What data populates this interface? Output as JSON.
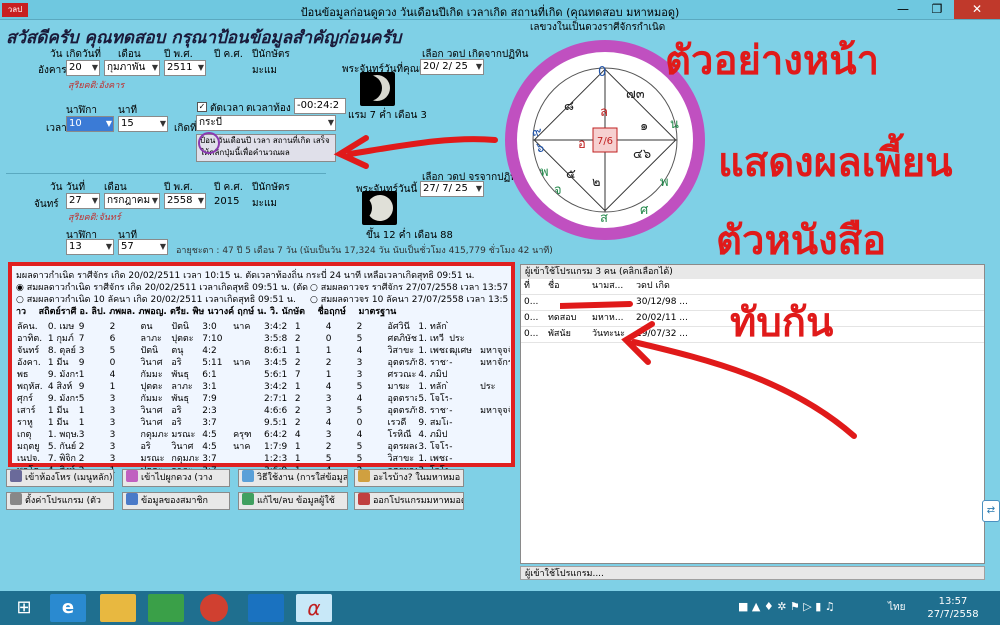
{
  "titlebar": {
    "badge": "วลป",
    "title": "ป้อนข้อมูลก่อนดูดวง วันเดือนปีเกิด เวลาเกิด สถานที่เกิด (คุณทดสอบ มหาหมอดู)"
  },
  "greeting": "สวัสดีครับ คุณทดสอบ กรุณาป้อนข้อมูลสำคัญก่อนครับ",
  "birth": {
    "h_day": "วัน",
    "h_date": "เกิดวันที่",
    "h_month": "เดือน",
    "h_year_be": "ปี พ.ศ.",
    "h_year_ce": "ปี ค.ศ.",
    "h_zodiac": "ปีนักษัตร",
    "weekday": "อังคาร",
    "date": "20",
    "month": "กุมภาพัน",
    "year_be": "2511",
    "year_ce": "",
    "zodiac": "มะแม",
    "sarit": "สุริยคติ:อังคาร",
    "h_hour": "นาฬิกา",
    "h_minute": "นาที",
    "time_label": "เวลา",
    "hour": "10",
    "minute": "15",
    "cut_label": "ตัดเวลา",
    "tz_label": "ตเวลาท้อง",
    "tz_value": "-00:24:2",
    "place_label": "เกิดที่",
    "place": "กระบี่",
    "note": "ป้อน วันเดือนปี เวลา สถานที่เกิด เสร็จให้คลิกปุ่มนี้เพื่อคำนวณผล",
    "moon_label": "พระจันทร์วันที่คุณเกิด",
    "moon_phase": "แรม 7 ค่ำ เดือน 3",
    "choose_label": "เลือก วดป เกิดจากปฏิทิน",
    "choose_value": "20/ 2/ 25"
  },
  "today": {
    "h_day": "วัน",
    "h_date": "วันที่",
    "h_month": "เดือน",
    "h_year_be": "ปี พ.ศ.",
    "h_year_ce": "ปี ค.ศ.",
    "h_zodiac": "ปีนักษัตร",
    "weekday": "จันทร์",
    "date": "27",
    "month": "กรกฎาคม",
    "year_be": "2558",
    "year_ce": "2015",
    "zodiac": "มะแม",
    "sarit": "สุริยคติ:จันทร์",
    "h_hour": "นาฬิกา",
    "h_minute": "นาที",
    "hour": "13",
    "minute": "57",
    "moon_label": "พระจันทร์วันนี้",
    "moon_phase": "ขึ้น 12 ค่ำ เดือน 88",
    "choose_label": "เลือก วดป จรจากปฏิทิน",
    "choose_value": "27/ 7/ 25",
    "age": "อายุชะตา : 47 ปี 5 เดือน 7 วัน (นับเป็นวัน 17,324 วัน นับเป็นชั่วโมง 415,779 ชั่วโมง 42 นาที)"
  },
  "wheel": {
    "label": "เลขวงในเป็นดวงราศีจักรกำเนิด",
    "center": "7/6",
    "houses": [
      "0",
      "๗๓",
      "๑",
      "๔๖",
      "๒",
      "๖",
      "๘",
      "๕",
      "๙",
      "น",
      "พ",
      "ศ",
      "จ",
      "ส",
      "พ",
      "อ",
      "ล"
    ]
  },
  "results": {
    "line1": "มผลดาวกำเนิด ราศีจักร เกิด 20/02/2511 เวลา 10:15 น. ตัดเวลาท้องถิ่น กระบี่ 24 นาที เหลือเวลาเกิดสุทธิ 09:51 น.",
    "line2a": "สมผลดาวกำเนิด ราศีจักร เกิด 20/02/2511 เวลาเกิดสุทธิ 09:51 น. (ตัด",
    "line2b": "สมผลดาวจร ราศีจักร 27/07/2558 เวลา 13:57",
    "line3a": "สมผลดาวกำเนิด 10 ลัคนา เกิด 20/02/2511 เวลาเกิดสุทธิ 09:51 น.",
    "line3b": "สมผลดาวจร 10 ลัคนา 27/07/2558 เวลา 13:5",
    "headers": [
      "าว",
      "สถิตย์ราศี",
      "อ. ลิป.",
      "ภพผล.",
      "ภพอญ.",
      "ตรีย.",
      "พิษ",
      "นวางค์",
      "ฤกษ์",
      "น.",
      "วิ.",
      "นักษัต",
      "ชื่อฤกษ์",
      "มาตรฐาน"
    ],
    "rows": [
      [
        "ลัคน.",
        "0. เมษ",
        "9",
        "2",
        "ตน",
        "ปัตนิ",
        "3:0",
        "นาค",
        "3:4:2",
        "1",
        "4",
        "2",
        "อัศวินี",
        "1. ทลักไท -"
      ],
      [
        "อาทิต.",
        "1 กุมภ์",
        "7",
        "6",
        "ลาภะ",
        "ปุตตะ",
        "7:10",
        "",
        "3:5:8",
        "2",
        "0",
        "5",
        "ศตภิษัช",
        "1. เทวี",
        "ประ"
      ],
      [
        "จันทร์",
        "8. ตุลย์",
        "3",
        "5",
        "ปัตนิ",
        "ตนุ",
        "4:2",
        "",
        "8:6:1",
        "1",
        "1",
        "4",
        "วิสาขะ",
        "1. เพชฌฆาต",
        "ฒุเศษ",
        "มหาจุจจ์"
      ],
      [
        "อังคา.",
        "1 มีน",
        "9",
        "0",
        "วินาศ",
        "อริ",
        "5:11",
        "นาค",
        "3:4:5",
        "2",
        "2",
        "3",
        "อุตตรภัทรบท",
        "8. ราชา",
        "-",
        "มหาจักร"
      ],
      [
        "พธ",
        "9. มังกร",
        "1",
        "4",
        "กัมมะ",
        "พันธุ",
        "6:1",
        "",
        "5:6:1",
        "7",
        "1",
        "3",
        "ศรวณะ",
        "4. ภมิปาโล -",
        ""
      ],
      [
        "พฤหัส.",
        "4 สิงห์",
        "9",
        "1",
        "ปุตตะ",
        "ลาภะ",
        "3:1",
        "",
        "3:4:2",
        "1",
        "4",
        "5",
        "มาฆะ",
        "1. ทลักไท -",
        "",
        "ประ"
      ],
      [
        "ศุกร์",
        "9. มังกร",
        "5",
        "3",
        "กัมมะ",
        "พันธุ",
        "7:9",
        "",
        "2:7:1",
        "2",
        "3",
        "4",
        "อุตตราสาฬ.",
        "5. โจโร",
        "-",
        ""
      ],
      [
        "เสาร์",
        "1 มีน",
        "1",
        "3",
        "วินาศ",
        "อริ",
        "2:3",
        "",
        "4:6:6",
        "2",
        "3",
        "5",
        "อุตตรภัทรบท",
        "8. ราชา",
        "-",
        "มหาจุจจ์"
      ],
      [
        "ราหู",
        "1 มีน",
        "1",
        "3",
        "วินาศ",
        "อริ",
        "3:7",
        "",
        "9.5:1",
        "2",
        "4",
        "0",
        "เรวดี",
        "9. สมโณ",
        "-",
        ""
      ],
      [
        "เกตุ",
        "1. พฤษภ",
        "3",
        "3",
        "กดุมภะ",
        "มรณะ",
        "4:5",
        "ครุฑ",
        "6:4:2",
        "4",
        "3",
        "4",
        "โรหิณี",
        "4. ภมิปาโล -",
        ""
      ],
      [
        "มฤตยู",
        "5. กันย์",
        "2",
        "3",
        "อริ",
        "วินาศ",
        "4:5",
        "นาค",
        "1:7:9",
        "1",
        "2",
        "5",
        "อุตรผลคุนี",
        "3. โจโร",
        "-",
        ""
      ],
      [
        "เนปจ.",
        "7. พิจิก",
        "2",
        "3",
        "มรณะ",
        "กดุมภะ",
        "3:7",
        "",
        "1:2:3",
        "1",
        "5",
        "5",
        "วิสาขะ",
        "1. เพชฌฆา.",
        "-",
        ""
      ],
      [
        "พลโต.",
        "4. สิงห์",
        "2",
        "1",
        "ปุตตะ",
        "ลาภะ",
        "3:7",
        "",
        "3:6:9",
        "1",
        "4",
        "2",
        "อุตรผลคุนี",
        "3. โจโร",
        "-",
        ""
      ]
    ]
  },
  "buttons": {
    "b1": "เข้าห้องโหร (เมนูหลัก)",
    "b2": "เข้าไปผูกดวง (วาง",
    "b3": "วิธีใช้งาน (การใส่ข้อมูล)",
    "b4": "อะไรบ้าง? ในมหาหมอ",
    "b5": "ตั้งค่าโปรแกรม (ตัว",
    "b6": "ข้อมูลของสมาชิก",
    "b7": "แก้ไข/ลบ ข้อมูลผู้ใช้",
    "b8": "ออกโปรแกรมมหาหมอดู"
  },
  "users": {
    "title": "ผู้เข้าใช้โปรแกรม 3 คน (คลิกเลือกได้)",
    "headers": [
      "ที่",
      "ชื่อ",
      "นามส...",
      "วดป เกิด"
    ],
    "rows": [
      [
        "0...",
        "",
        "",
        "30/12/98 ..."
      ],
      [
        "0...",
        "ทดสอบ",
        "มหาห...",
        "20/02/11 ..."
      ],
      [
        "0...",
        "พัสนัย",
        "วันทะนะ",
        "19/07/32 ..."
      ]
    ],
    "footer": "ผู้เข้าใช้โปรแกรม...."
  },
  "annotations": {
    "l1": "ตัวอย่างหน้า",
    "l2": "แสดงผลเพี้ยน",
    "l3": "ตัวหนังสือ",
    "l4": "ทับกัน"
  },
  "taskbar": {
    "time": "13:57",
    "date": "27/7/2558",
    "lang": "ไทย"
  }
}
